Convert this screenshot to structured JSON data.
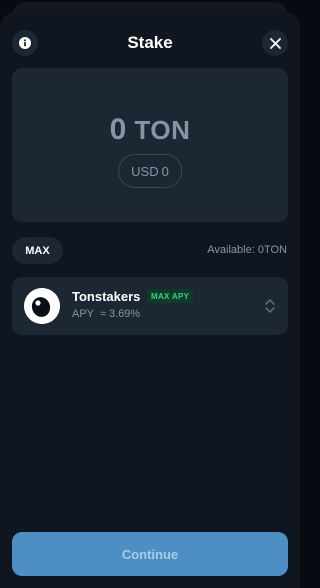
{
  "header": {
    "title": "Stake",
    "info_icon": "info-icon",
    "close_icon": "close-icon"
  },
  "amount": {
    "value": "0",
    "currency": "TON",
    "fiat_label": "USD",
    "fiat_value": "0"
  },
  "max_label": "MAX",
  "available": {
    "label": "Available:",
    "value": "0",
    "currency": "TON"
  },
  "pool": {
    "name": "Tonstakers",
    "badge": "MAX APY",
    "apy_label": "APY",
    "apy_value": "≈ 3.69%",
    "logo_icon": "tonstakers-logo-icon",
    "selector_icon": "chevron-up-down-icon"
  },
  "continue_label": "Continue",
  "colors": {
    "background": "#10161f",
    "card": "#1d2633",
    "accent_button": "#4d8fc4",
    "badge_text": "#39cc83",
    "muted_text": "#8994a3"
  }
}
